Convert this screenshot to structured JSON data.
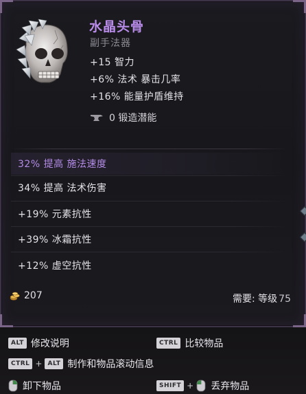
{
  "item": {
    "name": "水晶头骨",
    "type": "副手法器",
    "implicits": [
      "+15 智力",
      "+6% 法术 暴击几率",
      "+16% 能量护盾维持"
    ],
    "forging_potential": "0 锻造潜能"
  },
  "affixes": [
    {
      "text": "32% 提高 施法速度",
      "highlight": true
    },
    {
      "text": "34% 提高 法术伤害",
      "highlight": false
    },
    {
      "text": "+19% 元素抗性",
      "highlight": false
    },
    {
      "text": "+39% 冰霜抗性",
      "highlight": false
    },
    {
      "text": "+12% 虚空抗性",
      "highlight": false
    }
  ],
  "footer": {
    "gold": "207",
    "requirement_label": "需要: 等级",
    "requirement_level": "75"
  },
  "hints": {
    "alt_key": "ALT",
    "alt_label": "修改说明",
    "ctrl_key": "CTRL",
    "ctrl_label": "比较物品",
    "ctrl_alt_plus": "+",
    "ctrl_alt_label": "制作和物品滚动信息",
    "unequip_label": "卸下物品",
    "shift_key": "SHIFT",
    "shift_plus": "+",
    "drop_label": "丢弃物品"
  },
  "colors": {
    "item_name": "#b98cea",
    "highlight_affix": "#b48ce6",
    "frame": "#3d3346"
  }
}
